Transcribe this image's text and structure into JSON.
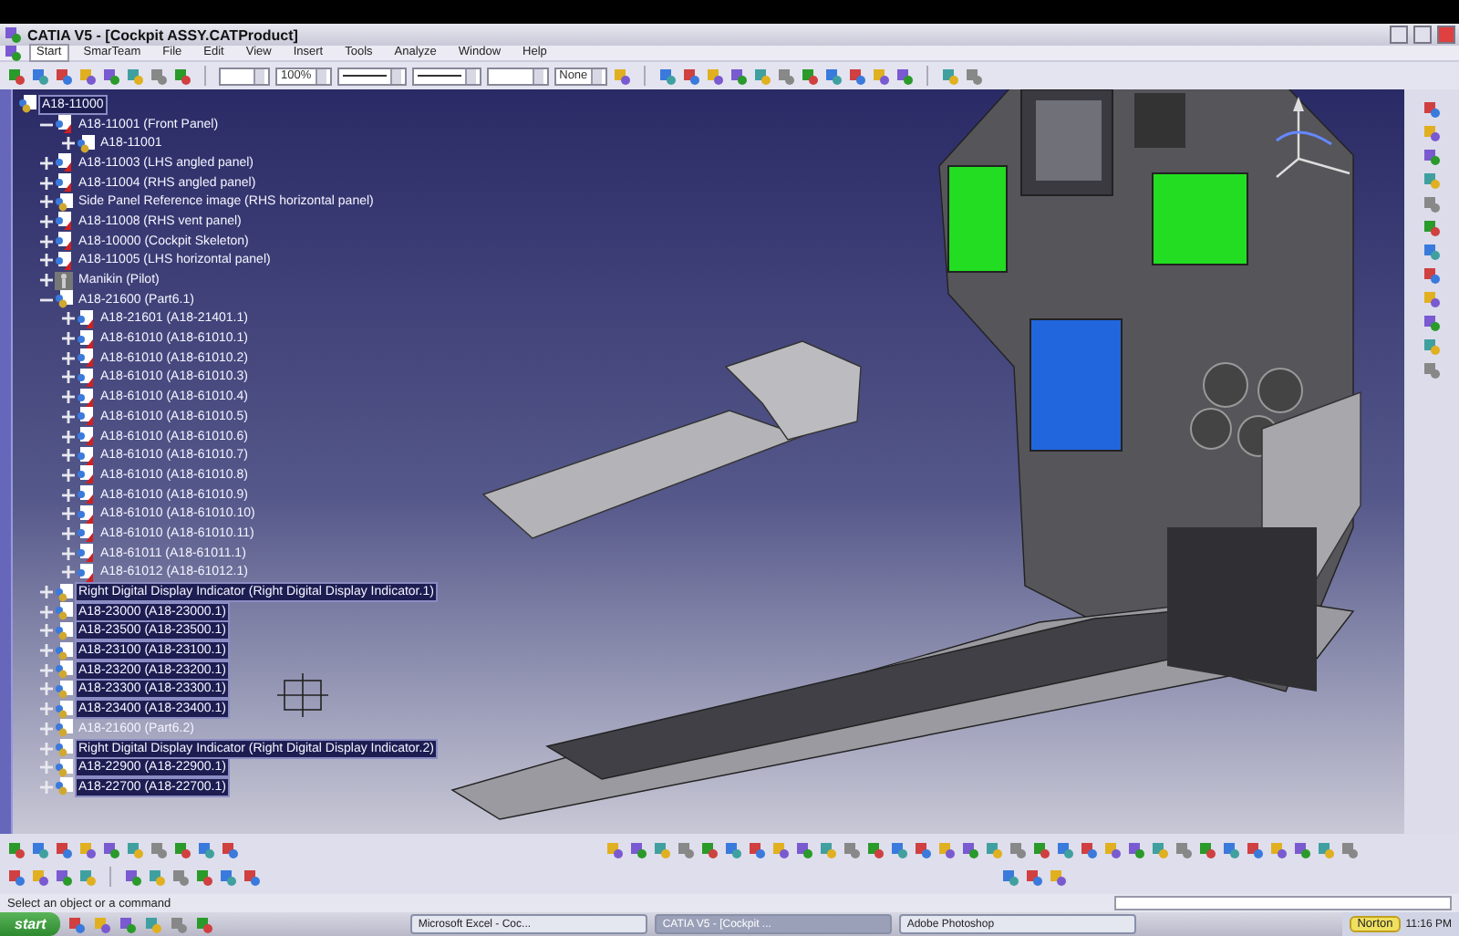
{
  "window": {
    "title": "CATIA V5 - [Cockpit ASSY.CATProduct]"
  },
  "menu": [
    {
      "label": "Start",
      "selected": true
    },
    {
      "label": "SmarTeam",
      "selected": false
    },
    {
      "label": "File",
      "selected": false
    },
    {
      "label": "Edit",
      "selected": false
    },
    {
      "label": "View",
      "selected": false
    },
    {
      "label": "Insert",
      "selected": false
    },
    {
      "label": "Tools",
      "selected": false
    },
    {
      "label": "Analyze",
      "selected": false
    },
    {
      "label": "Window",
      "selected": false
    },
    {
      "label": "Help",
      "selected": false
    }
  ],
  "toolbar": {
    "zoom": "100%",
    "layer": "None"
  },
  "tree": {
    "label": "A18-11000",
    "kind": "assembly",
    "selected": true,
    "children": [
      {
        "label": "A18-11001 (Front Panel)",
        "kind": "part",
        "selected": false,
        "expanded": true,
        "children": [
          {
            "label": "A18-11001",
            "kind": "assembly",
            "selected": false,
            "expanded": false
          }
        ]
      },
      {
        "label": "A18-11003 (LHS angled panel)",
        "kind": "part",
        "selected": false,
        "expanded": false
      },
      {
        "label": "A18-11004 (RHS angled panel)",
        "kind": "part",
        "selected": false,
        "expanded": false
      },
      {
        "label": "Side Panel Reference image (RHS horizontal panel)",
        "kind": "assembly",
        "selected": false,
        "expanded": false
      },
      {
        "label": "A18-11008 (RHS vent panel)",
        "kind": "part",
        "selected": false,
        "expanded": false
      },
      {
        "label": "A18-10000 (Cockpit Skeleton)",
        "kind": "part",
        "selected": false,
        "expanded": false
      },
      {
        "label": "A18-11005 (LHS horizontal panel)",
        "kind": "part",
        "selected": false,
        "expanded": false
      },
      {
        "label": "Manikin (Pilot)",
        "kind": "manikin",
        "selected": false,
        "expanded": false
      },
      {
        "label": "A18-21600 (Part6.1)",
        "kind": "assembly",
        "selected": false,
        "expanded": true,
        "children": [
          {
            "label": "A18-21601 (A18-21401.1)",
            "kind": "part",
            "selected": false,
            "expanded": false
          },
          {
            "label": "A18-61010 (A18-61010.1)",
            "kind": "part",
            "selected": false,
            "expanded": false
          },
          {
            "label": "A18-61010 (A18-61010.2)",
            "kind": "part",
            "selected": false,
            "expanded": false
          },
          {
            "label": "A18-61010 (A18-61010.3)",
            "kind": "part",
            "selected": false,
            "expanded": false
          },
          {
            "label": "A18-61010 (A18-61010.4)",
            "kind": "part",
            "selected": false,
            "expanded": false
          },
          {
            "label": "A18-61010 (A18-61010.5)",
            "kind": "part",
            "selected": false,
            "expanded": false
          },
          {
            "label": "A18-61010 (A18-61010.6)",
            "kind": "part",
            "selected": false,
            "expanded": false
          },
          {
            "label": "A18-61010 (A18-61010.7)",
            "kind": "part",
            "selected": false,
            "expanded": false
          },
          {
            "label": "A18-61010 (A18-61010.8)",
            "kind": "part",
            "selected": false,
            "expanded": false
          },
          {
            "label": "A18-61010 (A18-61010.9)",
            "kind": "part",
            "selected": false,
            "expanded": false
          },
          {
            "label": "A18-61010 (A18-61010.10)",
            "kind": "part",
            "selected": false,
            "expanded": false
          },
          {
            "label": "A18-61010 (A18-61010.11)",
            "kind": "part",
            "selected": false,
            "expanded": false
          },
          {
            "label": "A18-61011 (A18-61011.1)",
            "kind": "part",
            "selected": false,
            "expanded": false
          },
          {
            "label": "A18-61012 (A18-61012.1)",
            "kind": "part",
            "selected": false,
            "expanded": false
          }
        ]
      },
      {
        "label": "Right Digital Display Indicator (Right Digital Display Indicator.1)",
        "kind": "assembly",
        "selected": true,
        "expanded": false
      },
      {
        "label": "A18-23000 (A18-23000.1)",
        "kind": "assembly",
        "selected": true,
        "expanded": false
      },
      {
        "label": "A18-23500 (A18-23500.1)",
        "kind": "assembly",
        "selected": true,
        "expanded": false
      },
      {
        "label": "A18-23100 (A18-23100.1)",
        "kind": "assembly",
        "selected": true,
        "expanded": false
      },
      {
        "label": "A18-23200 (A18-23200.1)",
        "kind": "assembly",
        "selected": true,
        "expanded": false
      },
      {
        "label": "A18-23300 (A18-23300.1)",
        "kind": "assembly",
        "selected": true,
        "expanded": false
      },
      {
        "label": "A18-23400 (A18-23400.1)",
        "kind": "assembly",
        "selected": true,
        "expanded": false
      },
      {
        "label": "A18-21600 (Part6.2)",
        "kind": "assembly",
        "selected": false,
        "expanded": false
      },
      {
        "label": "Right Digital Display Indicator (Right Digital Display Indicator.2)",
        "kind": "assembly",
        "selected": true,
        "expanded": false
      },
      {
        "label": "A18-22900 (A18-22900.1)",
        "kind": "assembly",
        "selected": true,
        "expanded": false
      },
      {
        "label": "A18-22700 (A18-22700.1)",
        "kind": "assembly",
        "selected": true,
        "expanded": false
      }
    ]
  },
  "status_bar": {
    "message": "Select an object or a command"
  },
  "taskbar": {
    "start": "start",
    "tasks": [
      {
        "label": "Microsoft Excel - Coc...",
        "selected": false
      },
      {
        "label": "CATIA V5 - [Cockpit ...",
        "selected": true
      },
      {
        "label": "Adobe Photoshop",
        "selected": false
      }
    ],
    "norton": "Norton",
    "time": "11:16 PM"
  }
}
